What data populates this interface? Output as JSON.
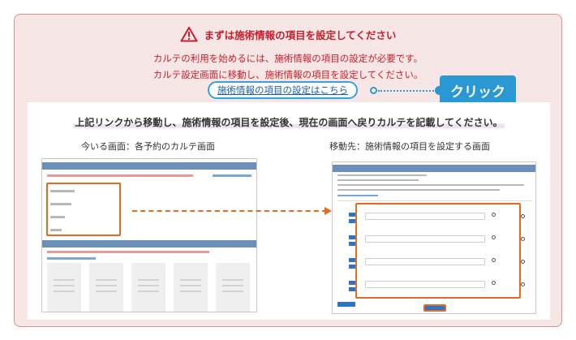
{
  "header": {
    "title": "まずは施術情報の項目を設定してください",
    "icon": "warning-triangle-icon",
    "accent_color": "#c81e2a"
  },
  "message": {
    "line1": "カルテの利用を始めるには、施術情報の項目の設定が必要です。",
    "line2": "カルテ設定画面に移動し、施術情報の項目を設定してください。",
    "link_label": "施術情報の項目の設定はこちら"
  },
  "click_badge": {
    "label": "クリック",
    "color": "#2a98d2"
  },
  "instruction": "上記リンクから移動し、施術情報の項目を設定後、現在の画面へ戻りカルテを記載してください。",
  "captions": {
    "current": "今いる画面：各予約のカルテ画面",
    "destination": "移動先：施術情報の項目を設定する画面"
  }
}
